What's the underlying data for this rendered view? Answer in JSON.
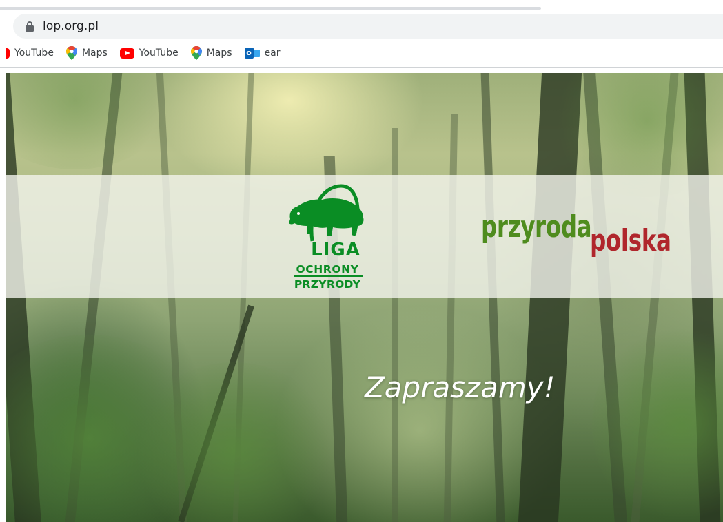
{
  "browser": {
    "url": "lop.org.pl",
    "bookmarks": [
      {
        "label": "YouTube",
        "icon": "youtube-icon"
      },
      {
        "label": "Maps",
        "icon": "maps-icon"
      },
      {
        "label": "YouTube",
        "icon": "youtube-icon"
      },
      {
        "label": "Maps",
        "icon": "maps-icon"
      },
      {
        "label": "ear",
        "icon": "outlook-icon"
      }
    ]
  },
  "page": {
    "lop_logo": {
      "line1": "LIGA",
      "line2": "OCHRONY",
      "line3": "PRZYRODY",
      "color": "#0a8d24"
    },
    "pp_logo": {
      "part1": "przyroda",
      "part2": "polska",
      "color1": "#4f8c1e",
      "color2": "#b0262c"
    },
    "welcome_text": "Zapraszamy!"
  }
}
